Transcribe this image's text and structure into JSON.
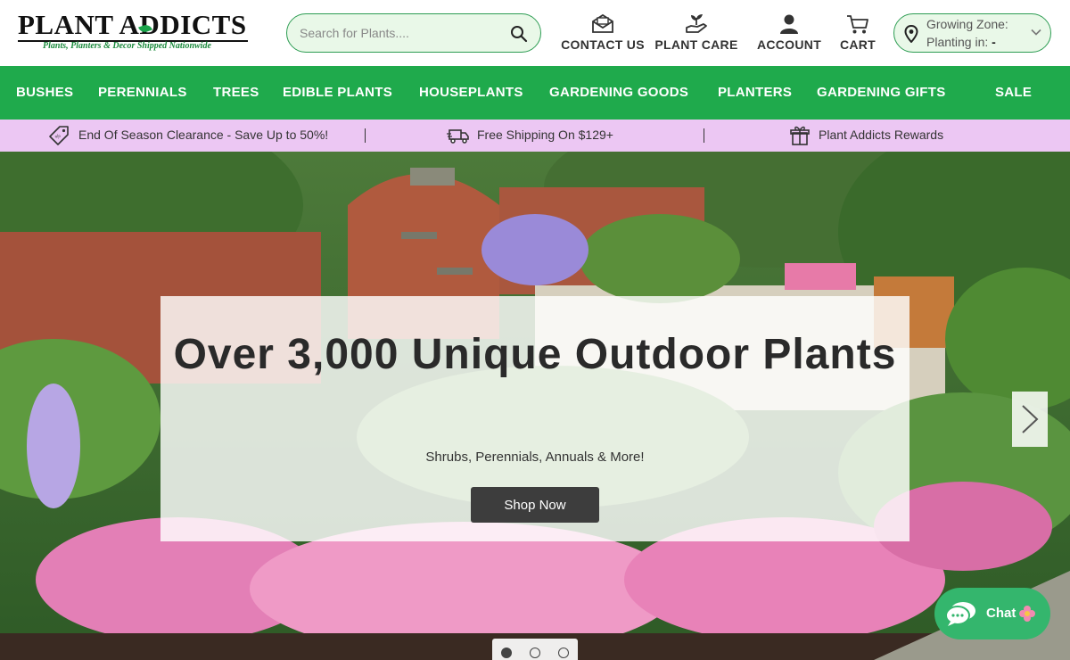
{
  "brand": {
    "name": "PLANT ADDICTS",
    "tagline": "Plants, Planters & Decor Shipped Nationwide"
  },
  "search": {
    "placeholder": "Search for Plants...."
  },
  "header_links": [
    {
      "label": "CONTACT US",
      "icon": "envelope-icon"
    },
    {
      "label": "PLANT CARE",
      "icon": "hand-plant-icon"
    },
    {
      "label": "ACCOUNT",
      "icon": "user-icon"
    },
    {
      "label": "CART",
      "icon": "cart-icon"
    }
  ],
  "zone": {
    "line1": "Growing Zone:",
    "line2_label": "Planting in:",
    "line2_value": "-"
  },
  "categories": [
    "BUSHES",
    "PERENNIALS",
    "TREES",
    "EDIBLE PLANTS",
    "HOUSEPLANTS",
    "GARDENING GOODS",
    "PLANTERS",
    "GARDENING GIFTS",
    "SALE"
  ],
  "promos": [
    {
      "text": "End Of Season Clearance - Save Up to 50%!",
      "icon": "tag-icon"
    },
    {
      "text": "Free Shipping On $129+",
      "icon": "truck-icon"
    },
    {
      "text": "Plant Addicts Rewards",
      "icon": "gift-icon"
    }
  ],
  "hero": {
    "title": "Over 3,000 Unique Outdoor Plants",
    "subtitle": "Shrubs, Perennials, Annuals & More!",
    "cta": "Shop Now",
    "slides_total": 3,
    "active_slide": 1
  },
  "chat": {
    "label": "Chat"
  },
  "colors": {
    "brand_green": "#1faa4c",
    "promo_pink": "#ecc7f3",
    "input_bg": "#e9f8e8"
  }
}
